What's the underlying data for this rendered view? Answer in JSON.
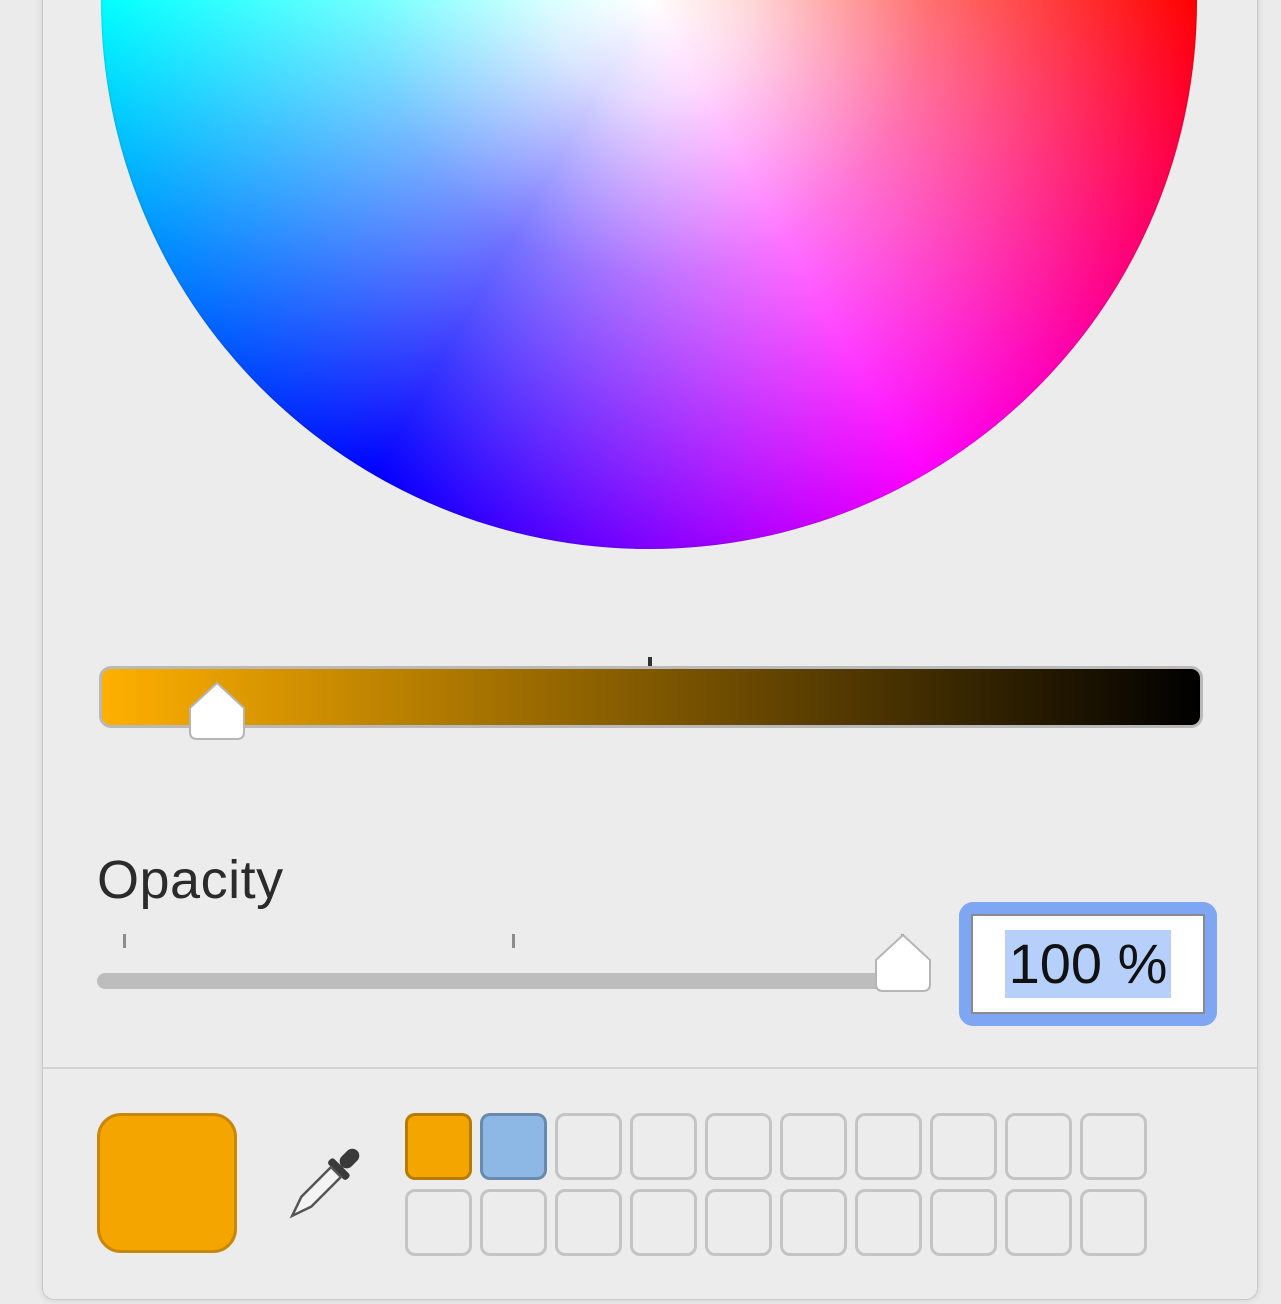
{
  "colors": {
    "current": "#f5a500",
    "brightness_start": "#ffb000",
    "brightness_end": "#000000"
  },
  "icons": {
    "eyedropper": "eyedropper-icon"
  },
  "brightness": {
    "level": 0.1
  },
  "opacity": {
    "label": "Opacity",
    "value": "100 %",
    "level": 1.0
  },
  "swatches": [
    "#f5a500",
    "#8db8e6",
    "",
    "",
    "",
    "",
    "",
    "",
    "",
    "",
    "",
    "",
    "",
    "",
    "",
    "",
    "",
    "",
    "",
    ""
  ]
}
